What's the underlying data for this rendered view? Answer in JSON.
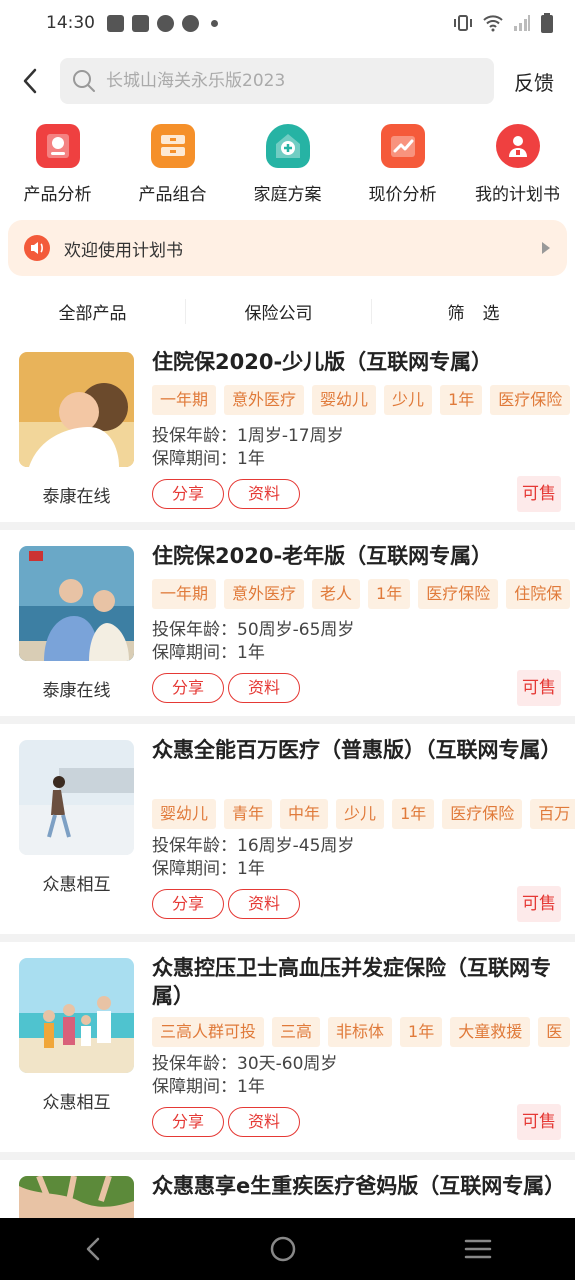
{
  "status": {
    "time": "14:30"
  },
  "header": {
    "search_placeholder": "长城山海关永乐版2023",
    "feedback": "反馈"
  },
  "quick_actions": [
    {
      "label": "产品分析",
      "icon": "product-analysis-icon",
      "color": "#ef4040"
    },
    {
      "label": "产品组合",
      "icon": "product-combination-icon",
      "color": "#f5902a"
    },
    {
      "label": "家庭方案",
      "icon": "family-plan-icon",
      "color": "#26b3a4"
    },
    {
      "label": "现价分析",
      "icon": "cash-value-analysis-icon",
      "color": "#f55a3a"
    },
    {
      "label": "我的计划书",
      "icon": "my-plan-icon",
      "color": "#ef4040"
    }
  ],
  "notice": {
    "text": "欢迎使用计划书"
  },
  "filters": [
    "全部产品",
    "保险公司",
    "筛选"
  ],
  "buttons": {
    "share": "分享",
    "material": "资料",
    "on_sale": "可售"
  },
  "products": [
    {
      "title": "住院保2020-少儿版（互联网专属）",
      "tags": [
        "一年期",
        "意外医疗",
        "婴幼儿",
        "少儿",
        "1年",
        "医疗保险"
      ],
      "age": "投保年龄：1周岁-17周岁",
      "period": "保障期间：1年",
      "company": "泰康在线"
    },
    {
      "title": "住院保2020-老年版（互联网专属）",
      "tags": [
        "一年期",
        "意外医疗",
        "老人",
        "1年",
        "医疗保险",
        "住院保"
      ],
      "age": "投保年龄：50周岁-65周岁",
      "period": "保障期间：1年",
      "company": "泰康在线"
    },
    {
      "title": "众惠全能百万医疗（普惠版）（互联网专属）",
      "tags": [
        "婴幼儿",
        "青年",
        "中年",
        "少儿",
        "1年",
        "医疗保险",
        "百万"
      ],
      "age": "投保年龄：16周岁-45周岁",
      "period": "保障期间：1年",
      "company": "众惠相互"
    },
    {
      "title": "众惠控压卫士高血压并发症保险（互联网专属）",
      "tags": [
        "三高人群可投",
        "三高",
        "非标体",
        "1年",
        "大童救援",
        "医"
      ],
      "age": "投保年龄：30天-60周岁",
      "period": "保障期间：1年",
      "company": "众惠相互"
    },
    {
      "title": "众惠惠享e生重疾医疗爸妈版（互联网专属）",
      "tags": [],
      "age": "",
      "period": "",
      "company": ""
    }
  ]
}
